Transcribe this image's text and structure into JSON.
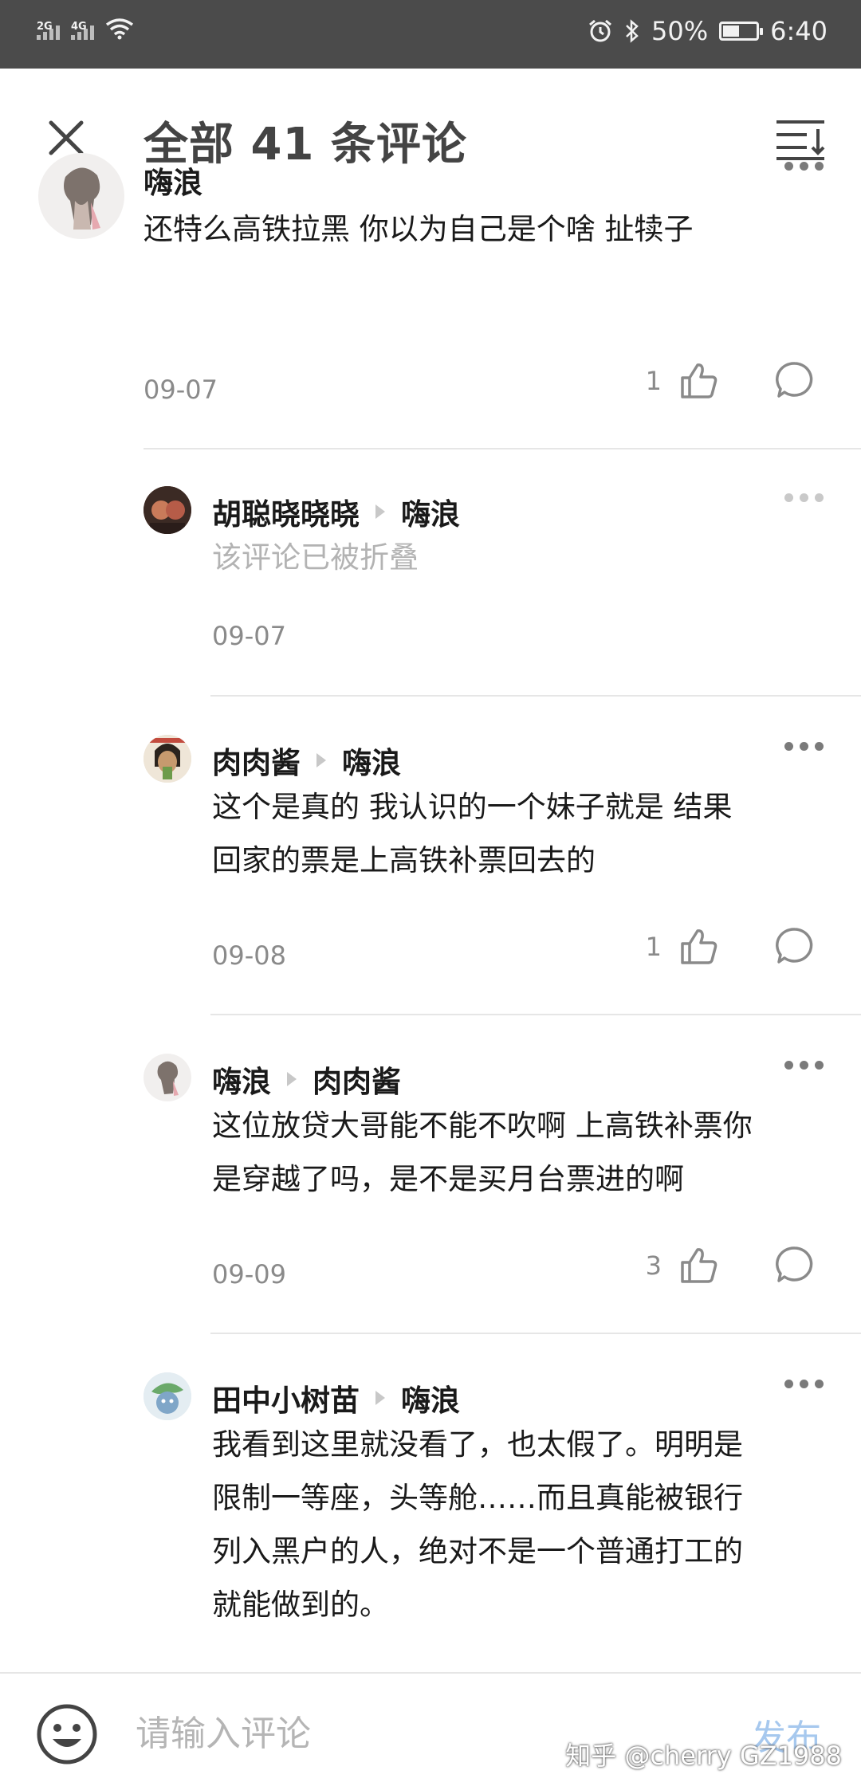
{
  "status_bar": {
    "network1": "2G",
    "network2": "4G",
    "battery_text": "50%",
    "battery_level": 0.5,
    "time": "6:40",
    "icons": [
      "signal-icon",
      "wifi-icon",
      "alarm-icon",
      "bluetooth-icon",
      "battery-icon"
    ]
  },
  "header": {
    "title": "全部 41 条评论",
    "close_icon": "close-icon",
    "sort_icon": "sort-icon"
  },
  "comments": [
    {
      "author": "嗨浪",
      "reply_to": "",
      "text_lines": [
        "还特么高铁拉黑 你以为自己是个啥 扯犊子"
      ],
      "date": "09-07",
      "likes": "1",
      "folded": false
    },
    {
      "author": "胡聪晓晓晓",
      "reply_to": "嗨浪",
      "text_lines": [
        "该评论已被折叠"
      ],
      "date": "09-07",
      "likes": "",
      "folded": true
    },
    {
      "author": "肉肉酱",
      "reply_to": "嗨浪",
      "text_lines": [
        "这个是真的 我认识的一个妹子就是 结果",
        "回家的票是上高铁补票回去的"
      ],
      "date": "09-08",
      "likes": "1",
      "folded": false
    },
    {
      "author": "嗨浪",
      "reply_to": "肉肉酱",
      "text_lines": [
        "这位放贷大哥能不能不吹啊 上高铁补票你",
        "是穿越了吗，是不是买月台票进的啊"
      ],
      "date": "09-09",
      "likes": "3",
      "folded": false
    },
    {
      "author": "田中小树苗",
      "reply_to": "嗨浪",
      "text_lines": [
        "我看到这里就没看了，也太假了。明明是",
        "限制一等座，头等舱……而且真能被银行",
        "列入黑户的人，绝对不是一个普通打工的",
        "就能做到的。"
      ],
      "date": "",
      "likes": "",
      "folded": false
    }
  ],
  "bottom": {
    "input_placeholder": "请输入评论",
    "publish_label": "发布",
    "watermark": "知乎 @cherry GZ1988"
  },
  "colors": {
    "status_bar_bg": "#4b4b4b",
    "publish_disabled": "#a6c8ee",
    "secondary_text": "#8a8a8a",
    "folded_text": "#b3b3b3"
  }
}
